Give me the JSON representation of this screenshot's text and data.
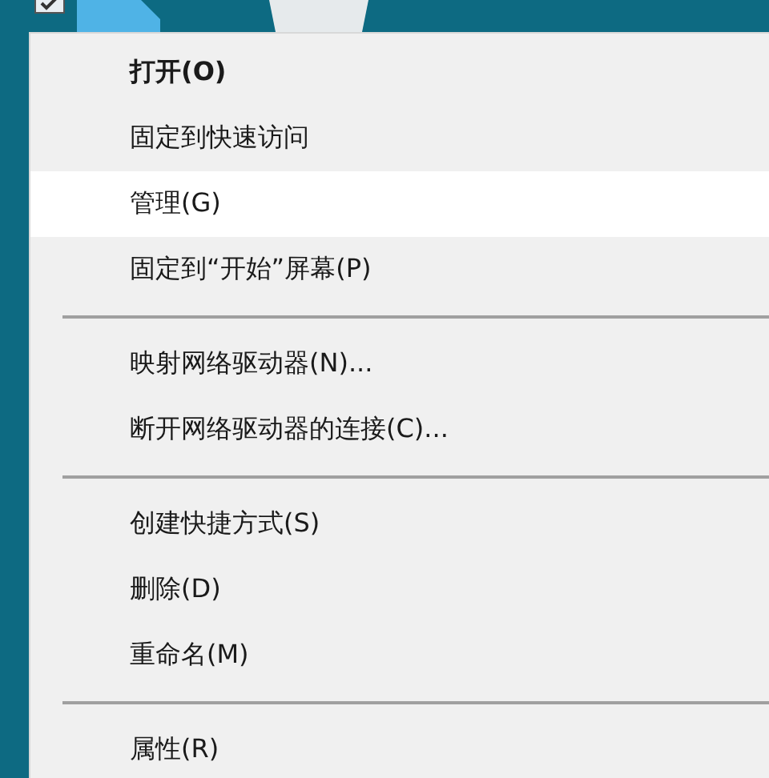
{
  "context_menu": {
    "items": [
      {
        "kind": "item",
        "label": "打开(O)",
        "default": true,
        "selected": false
      },
      {
        "kind": "item",
        "label": "固定到快速访问",
        "default": false,
        "selected": false
      },
      {
        "kind": "item",
        "label": "管理(G)",
        "default": false,
        "selected": true
      },
      {
        "kind": "item",
        "label": "固定到“开始”屏幕(P)",
        "default": false,
        "selected": false
      },
      {
        "kind": "separator"
      },
      {
        "kind": "item",
        "label": "映射网络驱动器(N)...",
        "default": false,
        "selected": false
      },
      {
        "kind": "item",
        "label": "断开网络驱动器的连接(C)...",
        "default": false,
        "selected": false
      },
      {
        "kind": "separator"
      },
      {
        "kind": "item",
        "label": "创建快捷方式(S)",
        "default": false,
        "selected": false
      },
      {
        "kind": "item",
        "label": "删除(D)",
        "default": false,
        "selected": false
      },
      {
        "kind": "item",
        "label": "重命名(M)",
        "default": false,
        "selected": false
      },
      {
        "kind": "separator"
      },
      {
        "kind": "item",
        "label": "属性(R)",
        "default": false,
        "selected": false
      }
    ]
  }
}
